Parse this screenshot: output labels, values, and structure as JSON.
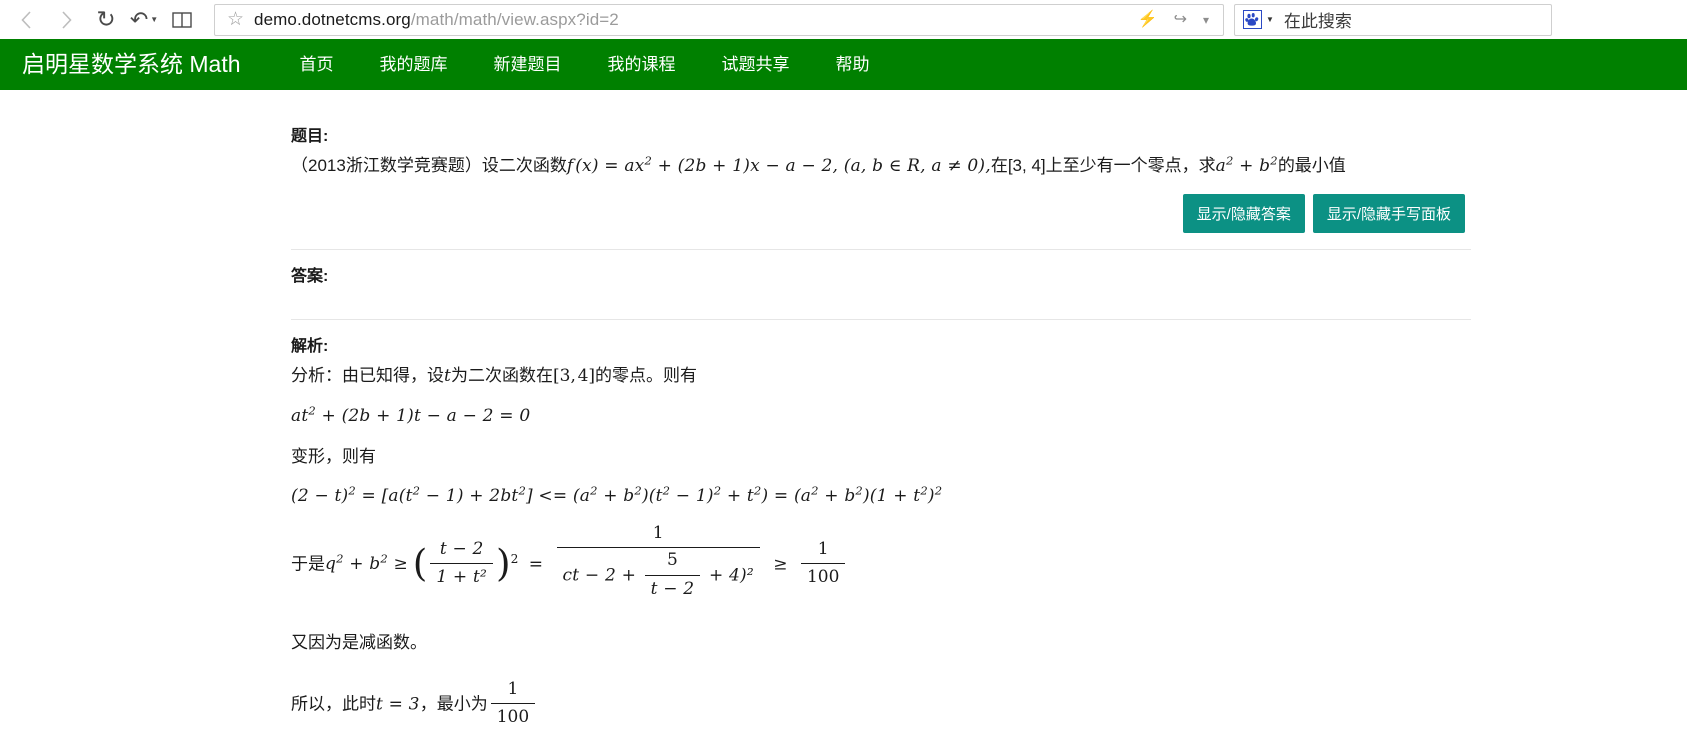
{
  "browser": {
    "back_label": "back-arrow",
    "forward_label": "forward-arrow",
    "reload_label": "reload",
    "history_label": "history",
    "reading_list_label": "reading-list",
    "url_main": "demo.dotnetcms.org",
    "url_path": "/math/math/view.aspx?id=2",
    "search_placeholder": "在此搜索"
  },
  "site": {
    "brand": "启明星数学系统 Math",
    "nav": [
      {
        "label": "首页"
      },
      {
        "label": "我的题库"
      },
      {
        "label": "新建题目"
      },
      {
        "label": "我的课程"
      },
      {
        "label": "试题共享"
      },
      {
        "label": "帮助"
      }
    ],
    "accent_color": "#008000",
    "button_color": "#0c9184"
  },
  "question": {
    "heading": "题目:",
    "source": "（2013浙江数学竞赛题）",
    "text_1": "设二次函数",
    "text_2": "在[3, 4]上至少有一个零点，求",
    "text_3": "的最小值",
    "formula_fx": "f (x) = ax² + (2b + 1)x − a − 2, (a, b ∈ R, a ≠ 0),",
    "formula_target": "a² + b²"
  },
  "buttons": {
    "toggle_answer": "显示/隐藏答案",
    "toggle_handwriting": "显示/隐藏手写面板"
  },
  "answer": {
    "heading": "答案:",
    "body": ""
  },
  "analysis": {
    "heading": "解析:",
    "line_intro": "分析：由已知得，设t为二次函数在[3, 4]的零点。则有",
    "eq_1": "at² + (2b + 1)t − a − 2 = 0",
    "line_transform": "变形，则有",
    "eq_2": "(2 − t)² = [a(t² − 1) + 2bt²] <= (a² + b²)(t² − 1)² + t²) = (a² + b²)(1 + t²)²",
    "eq_3_prefix": "于是",
    "eq_3_lhs": "q² + b² ≥",
    "eq_3_frac_num": "t − 2",
    "eq_3_frac_den": "1 + t²",
    "eq_3_rhs_num": "1",
    "eq_3_rhs_den_a": "ct − 2 +",
    "eq_3_rhs_den_frac_num": "5",
    "eq_3_rhs_den_frac_den": "t − 2",
    "eq_3_rhs_den_b": "+ 4)²",
    "eq_3_bound_num": "1",
    "eq_3_bound_den": "100",
    "line_decreasing": "又因为是减函数。",
    "line_conclusion_a": "所以，此时",
    "line_conclusion_t": "t = 3",
    "line_conclusion_b": "，最小为",
    "line_conclusion_num": "1",
    "line_conclusion_den": "100"
  }
}
